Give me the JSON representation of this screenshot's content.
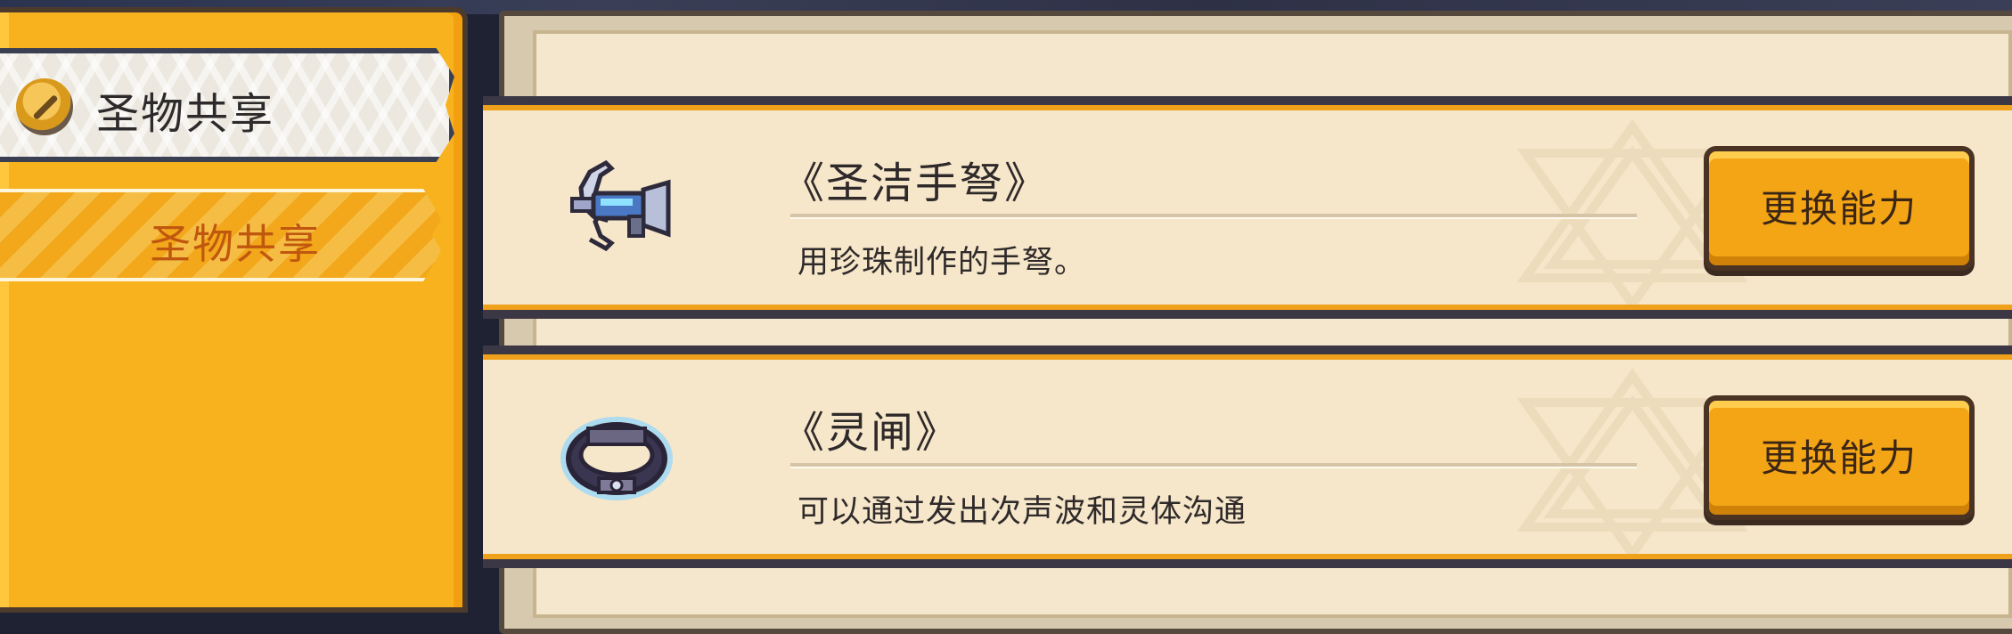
{
  "sidebar": {
    "header_title": "圣物共享",
    "items": [
      {
        "label": "圣物共享",
        "selected": true
      }
    ]
  },
  "relics": [
    {
      "name": "《圣洁手弩》",
      "description": "用珍珠制作的手弩。",
      "icon": "crossbow-icon",
      "button_label": "更换能力"
    },
    {
      "name": "《灵闸》",
      "description": "可以通过发出次声波和灵体沟通",
      "icon": "spirit-ring-icon",
      "button_label": "更换能力"
    }
  ],
  "colors": {
    "sidebar": "#f7b21e",
    "card_bg": "#f6e6ca",
    "button": "#f3a516",
    "accent_orange_text": "#c0570f",
    "dark_border": "#3b3745"
  }
}
